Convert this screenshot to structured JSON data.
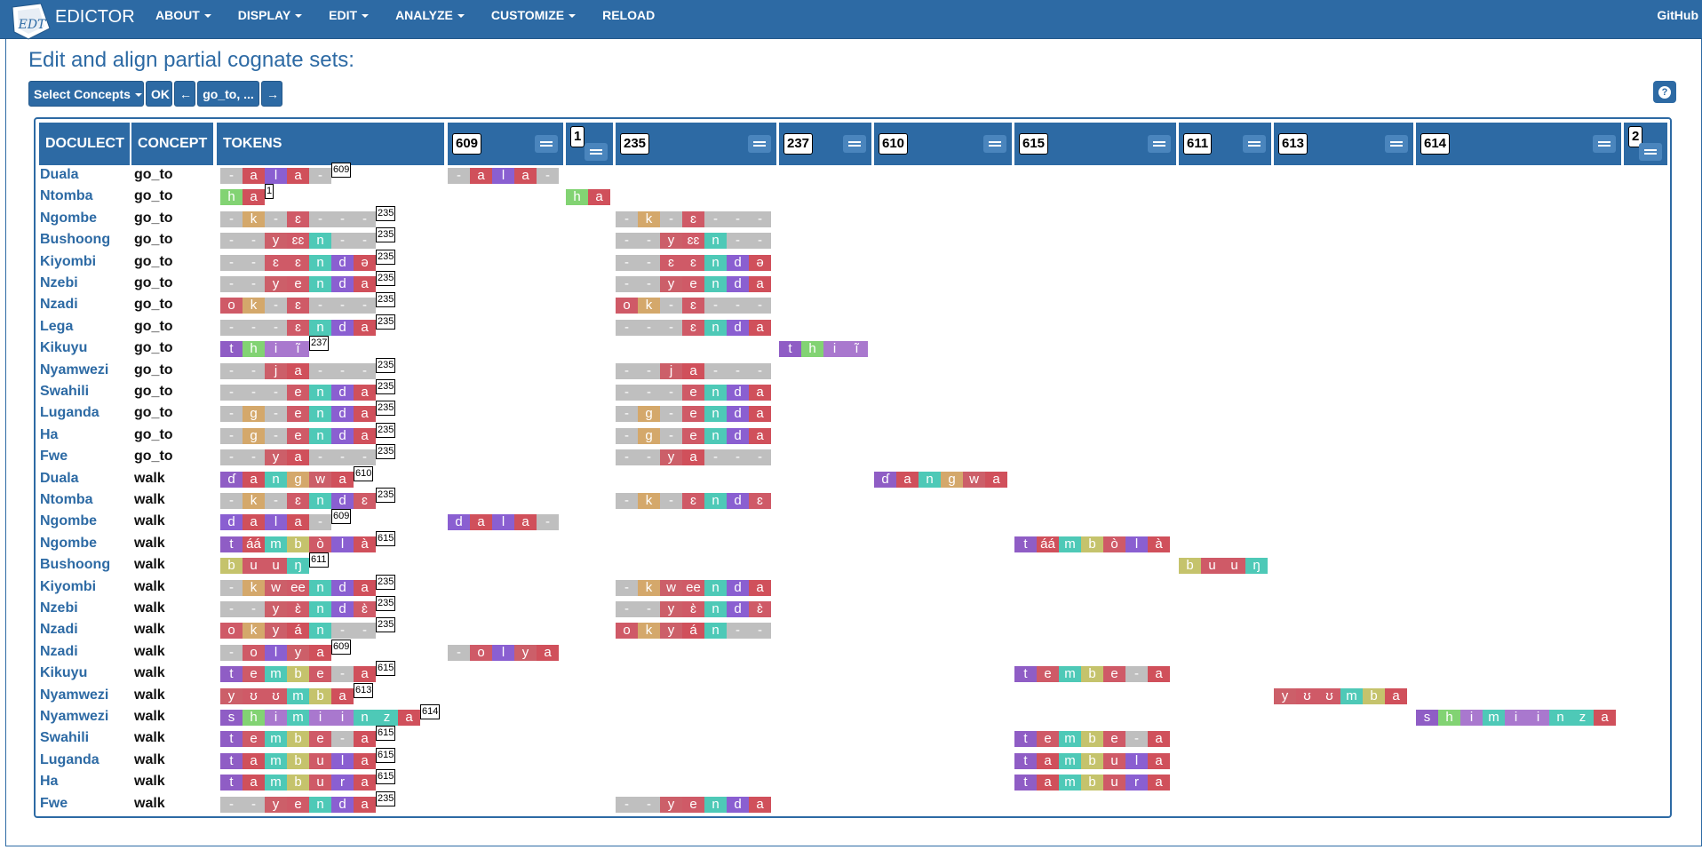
{
  "navbar": {
    "logo": "EDICTOR",
    "logo_mark": "EDT",
    "menu": [
      "ABOUT",
      "DISPLAY",
      "EDIT",
      "ANALYZE",
      "CUSTOMIZE",
      "RELOAD"
    ],
    "right_link": "GitHub"
  },
  "page": {
    "title": "Edit and align partial cognate sets:"
  },
  "toolbar": {
    "select_concepts": "Select Concepts",
    "ok": "OK",
    "prev": "←",
    "current": "go_to, ...",
    "next": "→",
    "help": "?"
  },
  "table": {
    "headers": [
      "DOCULECT",
      "CONCEPT",
      "TOKENS"
    ],
    "cognate_columns": [
      "609",
      "1",
      "235",
      "237",
      "610",
      "615",
      "611",
      "613",
      "614",
      "2"
    ]
  },
  "colors": {
    "gap": "#bfbfbf",
    "vowel_a": "#d0505b",
    "vowel_e": "#cf5a67",
    "vowel_i": "#a978ce",
    "nasal": "#4ec9b7",
    "liquid": "#8a5fd1",
    "stop_dental": "#8f5dc5",
    "stop_velar": "#d4a86b",
    "glide": "#cc5f69",
    "bilabial": "#8acb7d",
    "h": "#82d373",
    "b": "#c5c36c",
    "header": "#2d6aa4"
  },
  "rows": [
    {
      "doculect": "Duala",
      "concept": "go_to",
      "tokens": [
        "-",
        "a",
        "l",
        "a",
        "-"
      ],
      "badge": "609",
      "cognates": [
        {
          "column": "609",
          "alignment": [
            "-",
            "a",
            "l",
            "a",
            "-"
          ]
        }
      ]
    },
    {
      "doculect": "Ntomba",
      "concept": "go_to",
      "tokens": [
        "h",
        "a"
      ],
      "badge": "1",
      "cognates": [
        {
          "column": "1",
          "alignment": [
            "h",
            "a"
          ]
        }
      ]
    },
    {
      "doculect": "Ngombe",
      "concept": "go_to",
      "tokens": [
        "-",
        "k",
        "-",
        "ɛ",
        "-",
        "-",
        "-"
      ],
      "badge": "235",
      "cognates": [
        {
          "column": "235",
          "alignment": [
            "-",
            "k",
            "-",
            "ɛ",
            "-",
            "-",
            "-"
          ]
        }
      ]
    },
    {
      "doculect": "Bushoong",
      "concept": "go_to",
      "tokens": [
        "-",
        "-",
        "y",
        "ɛɛ",
        "n",
        "-",
        "-"
      ],
      "badge": "235",
      "cognates": [
        {
          "column": "235",
          "alignment": [
            "-",
            "-",
            "y",
            "ɛɛ",
            "n",
            "-",
            "-"
          ]
        }
      ]
    },
    {
      "doculect": "Kiyombi",
      "concept": "go_to",
      "tokens": [
        "-",
        "-",
        "ɛ",
        "ɛ",
        "n",
        "d",
        "ə"
      ],
      "badge": "235",
      "cognates": [
        {
          "column": "235",
          "alignment": [
            "-",
            "-",
            "ɛ",
            "ɛ",
            "n",
            "d",
            "ə"
          ]
        }
      ]
    },
    {
      "doculect": "Nzebi",
      "concept": "go_to",
      "tokens": [
        "-",
        "-",
        "y",
        "e",
        "n",
        "d",
        "a"
      ],
      "badge": "235",
      "cognates": [
        {
          "column": "235",
          "alignment": [
            "-",
            "-",
            "y",
            "e",
            "n",
            "d",
            "a"
          ]
        }
      ]
    },
    {
      "doculect": "Nzadi",
      "concept": "go_to",
      "tokens": [
        "o",
        "k",
        "-",
        "ɛ",
        "-",
        "-",
        "-"
      ],
      "badge": "235",
      "cognates": [
        {
          "column": "235",
          "alignment": [
            "o",
            "k",
            "-",
            "ɛ",
            "-",
            "-",
            "-"
          ]
        }
      ]
    },
    {
      "doculect": "Lega",
      "concept": "go_to",
      "tokens": [
        "-",
        "-",
        "-",
        "ɛ",
        "n",
        "d",
        "a"
      ],
      "badge": "235",
      "cognates": [
        {
          "column": "235",
          "alignment": [
            "-",
            "-",
            "-",
            "ɛ",
            "n",
            "d",
            "a"
          ]
        }
      ]
    },
    {
      "doculect": "Kikuyu",
      "concept": "go_to",
      "tokens": [
        "t",
        "h",
        "i",
        "ĩ"
      ],
      "badge": "237",
      "cognates": [
        {
          "column": "237",
          "alignment": [
            "t",
            "h",
            "i",
            "ĩ"
          ]
        }
      ]
    },
    {
      "doculect": "Nyamwezi",
      "concept": "go_to",
      "tokens": [
        "-",
        "-",
        "j",
        "a",
        "-",
        "-",
        "-"
      ],
      "badge": "235",
      "cognates": [
        {
          "column": "235",
          "alignment": [
            "-",
            "-",
            "j",
            "a",
            "-",
            "-",
            "-"
          ]
        }
      ]
    },
    {
      "doculect": "Swahili",
      "concept": "go_to",
      "tokens": [
        "-",
        "-",
        "-",
        "e",
        "n",
        "d",
        "a"
      ],
      "badge": "235",
      "cognates": [
        {
          "column": "235",
          "alignment": [
            "-",
            "-",
            "-",
            "e",
            "n",
            "d",
            "a"
          ]
        }
      ]
    },
    {
      "doculect": "Luganda",
      "concept": "go_to",
      "tokens": [
        "-",
        "g",
        "-",
        "e",
        "n",
        "d",
        "a"
      ],
      "badge": "235",
      "cognates": [
        {
          "column": "235",
          "alignment": [
            "-",
            "g",
            "-",
            "e",
            "n",
            "d",
            "a"
          ]
        }
      ]
    },
    {
      "doculect": "Ha",
      "concept": "go_to",
      "tokens": [
        "-",
        "g",
        "-",
        "e",
        "n",
        "d",
        "a"
      ],
      "badge": "235",
      "cognates": [
        {
          "column": "235",
          "alignment": [
            "-",
            "g",
            "-",
            "e",
            "n",
            "d",
            "a"
          ]
        }
      ]
    },
    {
      "doculect": "Fwe",
      "concept": "go_to",
      "tokens": [
        "-",
        "-",
        "y",
        "a",
        "-",
        "-",
        "-"
      ],
      "badge": "235",
      "cognates": [
        {
          "column": "235",
          "alignment": [
            "-",
            "-",
            "y",
            "a",
            "-",
            "-",
            "-"
          ]
        }
      ]
    },
    {
      "doculect": "Duala",
      "concept": "walk",
      "tokens": [
        "ɗ",
        "a",
        "n",
        "g",
        "w",
        "a"
      ],
      "badge": "610",
      "cognates": [
        {
          "column": "610",
          "alignment": [
            "ɗ",
            "a",
            "n",
            "g",
            "w",
            "a"
          ]
        }
      ]
    },
    {
      "doculect": "Ntomba",
      "concept": "walk",
      "tokens": [
        "-",
        "k",
        "-",
        "ɛ",
        "n",
        "d",
        "ɛ"
      ],
      "badge": "235",
      "cognates": [
        {
          "column": "235",
          "alignment": [
            "-",
            "k",
            "-",
            "ɛ",
            "n",
            "d",
            "ɛ"
          ]
        }
      ]
    },
    {
      "doculect": "Ngombe",
      "concept": "walk",
      "tokens": [
        "d",
        "a",
        "l",
        "a",
        "-"
      ],
      "badge": "609",
      "cognates": [
        {
          "column": "609",
          "alignment": [
            "d",
            "a",
            "l",
            "a",
            "-"
          ]
        }
      ]
    },
    {
      "doculect": "Ngombe",
      "concept": "walk",
      "tokens": [
        "t",
        "áá",
        "m",
        "b",
        "ò",
        "l",
        "à"
      ],
      "badge": "615",
      "cognates": [
        {
          "column": "615",
          "alignment": [
            "t",
            "áá",
            "m",
            "b",
            "ò",
            "l",
            "à"
          ]
        }
      ]
    },
    {
      "doculect": "Bushoong",
      "concept": "walk",
      "tokens": [
        "b",
        "u",
        "u",
        "ŋ"
      ],
      "badge": "611",
      "cognates": [
        {
          "column": "611",
          "alignment": [
            "b",
            "u",
            "u",
            "ŋ"
          ]
        }
      ]
    },
    {
      "doculect": "Kiyombi",
      "concept": "walk",
      "tokens": [
        "-",
        "k",
        "w",
        "ee",
        "n",
        "d",
        "a"
      ],
      "badge": "235",
      "cognates": [
        {
          "column": "235",
          "alignment": [
            "-",
            "k",
            "w",
            "ee",
            "n",
            "d",
            "a"
          ]
        }
      ]
    },
    {
      "doculect": "Nzebi",
      "concept": "walk",
      "tokens": [
        "-",
        "-",
        "y",
        "ɛ̀",
        "n",
        "d",
        "ɛ̀"
      ],
      "badge": "235",
      "cognates": [
        {
          "column": "235",
          "alignment": [
            "-",
            "-",
            "y",
            "ɛ̀",
            "n",
            "d",
            "ɛ̀"
          ]
        }
      ]
    },
    {
      "doculect": "Nzadi",
      "concept": "walk",
      "tokens": [
        "o",
        "k",
        "y",
        "á",
        "n",
        "-",
        "-"
      ],
      "badge": "235",
      "cognates": [
        {
          "column": "235",
          "alignment": [
            "o",
            "k",
            "y",
            "á",
            "n",
            "-",
            "-"
          ]
        }
      ]
    },
    {
      "doculect": "Nzadi",
      "concept": "walk",
      "tokens": [
        "-",
        "o",
        "l",
        "y",
        "a"
      ],
      "badge": "609",
      "cognates": [
        {
          "column": "609",
          "alignment": [
            "-",
            "o",
            "l",
            "y",
            "a"
          ]
        }
      ]
    },
    {
      "doculect": "Kikuyu",
      "concept": "walk",
      "tokens": [
        "t",
        "e",
        "m",
        "b",
        "e",
        "-",
        "a"
      ],
      "badge": "615",
      "cognates": [
        {
          "column": "615",
          "alignment": [
            "t",
            "e",
            "m",
            "b",
            "e",
            "-",
            "a"
          ]
        }
      ]
    },
    {
      "doculect": "Nyamwezi",
      "concept": "walk",
      "tokens": [
        "y",
        "ʊ",
        "ʊ",
        "m",
        "b",
        "a"
      ],
      "badge": "613",
      "cognates": [
        {
          "column": "613",
          "alignment": [
            "y",
            "ʊ",
            "ʊ",
            "m",
            "b",
            "a"
          ]
        }
      ]
    },
    {
      "doculect": "Nyamwezi",
      "concept": "walk",
      "tokens": [
        "s",
        "h",
        "i",
        "m",
        "i",
        "i",
        "n",
        "z",
        "a"
      ],
      "badge": "614",
      "cognates": [
        {
          "column": "614",
          "alignment": [
            "s",
            "h",
            "i",
            "m",
            "i",
            "i",
            "n",
            "z",
            "a"
          ]
        }
      ]
    },
    {
      "doculect": "Swahili",
      "concept": "walk",
      "tokens": [
        "t",
        "e",
        "m",
        "b",
        "e",
        "-",
        "a"
      ],
      "badge": "615",
      "cognates": [
        {
          "column": "615",
          "alignment": [
            "t",
            "e",
            "m",
            "b",
            "e",
            "-",
            "a"
          ]
        }
      ]
    },
    {
      "doculect": "Luganda",
      "concept": "walk",
      "tokens": [
        "t",
        "a",
        "m",
        "b",
        "u",
        "l",
        "a"
      ],
      "badge": "615",
      "cognates": [
        {
          "column": "615",
          "alignment": [
            "t",
            "a",
            "m",
            "b",
            "u",
            "l",
            "a"
          ]
        }
      ]
    },
    {
      "doculect": "Ha",
      "concept": "walk",
      "tokens": [
        "t",
        "a",
        "m",
        "b",
        "u",
        "r",
        "a"
      ],
      "badge": "615",
      "cognates": [
        {
          "column": "615",
          "alignment": [
            "t",
            "a",
            "m",
            "b",
            "u",
            "r",
            "a"
          ]
        }
      ]
    },
    {
      "doculect": "Fwe",
      "concept": "walk",
      "tokens": [
        "-",
        "-",
        "y",
        "e",
        "n",
        "d",
        "a"
      ],
      "badge": "235",
      "cognates": [
        {
          "column": "235",
          "alignment": [
            "-",
            "-",
            "y",
            "e",
            "n",
            "d",
            "a"
          ]
        }
      ]
    }
  ]
}
